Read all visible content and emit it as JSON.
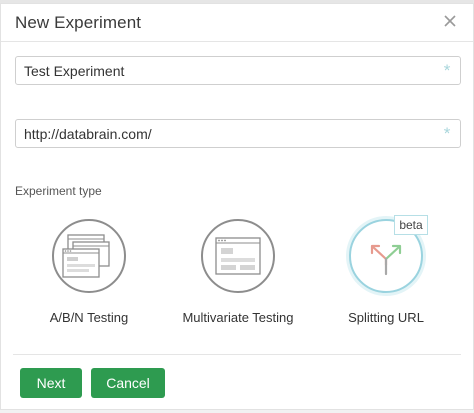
{
  "dialog": {
    "title": "New Experiment"
  },
  "form": {
    "name_value": "Test Experiment",
    "url_value": "http://databrain.com/",
    "required_marker": "*",
    "type_label": "Experiment type",
    "types": [
      {
        "label": "A/B/N Testing",
        "icon": "ab-testing-icon",
        "selected": false
      },
      {
        "label": "Multivariate Testing",
        "icon": "multivariate-icon",
        "selected": false
      },
      {
        "label": "Splitting URL",
        "icon": "split-url-icon",
        "selected": true,
        "badge": "beta"
      }
    ]
  },
  "footer": {
    "next_label": "Next",
    "cancel_label": "Cancel"
  },
  "colors": {
    "primary_button": "#2e9b50",
    "selected_ring": "#9ad3df",
    "required_marker": "#a9d6dc",
    "split_arrow_red": "#e79a8e",
    "split_arrow_green": "#8fce94"
  }
}
